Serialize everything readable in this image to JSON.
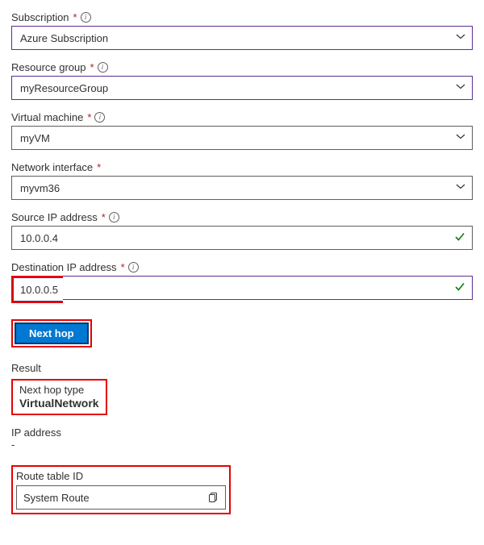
{
  "fields": {
    "subscription": {
      "label": "Subscription",
      "value": "Azure Subscription"
    },
    "resource_group": {
      "label": "Resource group",
      "value": "myResourceGroup"
    },
    "virtual_machine": {
      "label": "Virtual machine",
      "value": "myVM"
    },
    "network_interface": {
      "label": "Network interface",
      "value": "myvm36"
    },
    "source_ip": {
      "label": "Source IP address",
      "value": "10.0.0.4"
    },
    "dest_ip": {
      "label": "Destination IP address",
      "value": "10.0.0.5"
    }
  },
  "actions": {
    "next_hop": "Next hop"
  },
  "result": {
    "heading": "Result",
    "next_hop_type_label": "Next hop type",
    "next_hop_type_value": "VirtualNetwork",
    "ip_label": "IP address",
    "ip_value": "-",
    "route_table_label": "Route table ID",
    "route_table_value": "System Route"
  }
}
